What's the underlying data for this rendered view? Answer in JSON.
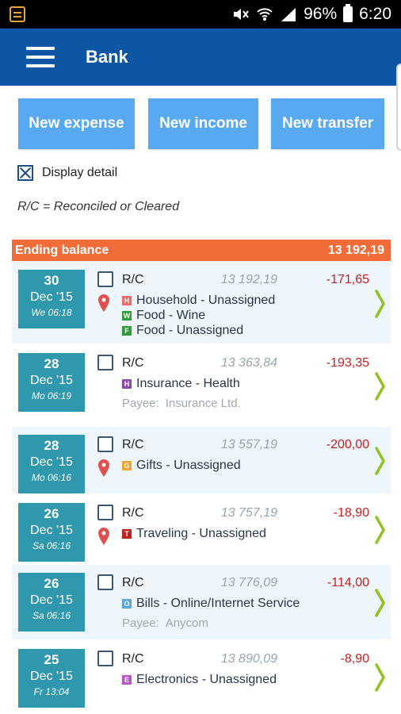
{
  "status_bar": {
    "battery": "96%",
    "time": "6:20"
  },
  "app_bar": {
    "title": "Bank"
  },
  "buttons": {
    "new_expense": "New expense",
    "new_income": "New income",
    "new_transfer": "New transfer"
  },
  "display_detail": {
    "label": "Display detail",
    "checked": true
  },
  "legend": "R/C = Reconciled or Cleared",
  "ending_balance": {
    "label": "Ending balance",
    "value": "13 192,19"
  },
  "transactions": [
    {
      "day": "30",
      "month": "Dec '15",
      "weekday_time": "We 06:18",
      "rc": "R/C",
      "running_balance": "13 192,19",
      "amount": "-171,65",
      "has_location": true,
      "categories": [
        {
          "badge": "H",
          "color": "#ec6a6a",
          "text": "Household - Unassigned"
        },
        {
          "badge": "W",
          "color": "#2e9d3a",
          "text": "Food - Wine"
        },
        {
          "badge": "F",
          "color": "#2e9d3a",
          "text": "Food - Unassigned"
        }
      ],
      "payee_label": "",
      "payee": ""
    },
    {
      "day": "28",
      "month": "Dec '15",
      "weekday_time": "Mo 06:19",
      "rc": "R/C",
      "running_balance": "13 363,84",
      "amount": "-193,35",
      "has_location": false,
      "categories": [
        {
          "badge": "H",
          "color": "#8b4aa8",
          "text": "Insurance - Health"
        }
      ],
      "payee_label": "Payee:",
      "payee": "Insurance Ltd."
    },
    {
      "day": "28",
      "month": "Dec '15",
      "weekday_time": "Mo 06:16",
      "rc": "R/C",
      "running_balance": "13 557,19",
      "amount": "-200,00",
      "has_location": true,
      "categories": [
        {
          "badge": "G",
          "color": "#f0a530",
          "text": "Gifts - Unassigned"
        }
      ],
      "payee_label": "",
      "payee": ""
    },
    {
      "day": "26",
      "month": "Dec '15",
      "weekday_time": "Sa 06:16",
      "rc": "R/C",
      "running_balance": "13 757,19",
      "amount": "-18,90",
      "has_location": true,
      "categories": [
        {
          "badge": "T",
          "color": "#c41e1e",
          "text": "Traveling - Unassigned"
        }
      ],
      "payee_label": "",
      "payee": ""
    },
    {
      "day": "26",
      "month": "Dec '15",
      "weekday_time": "Sa 06:16",
      "rc": "R/C",
      "running_balance": "13 776,09",
      "amount": "-114,00",
      "has_location": false,
      "categories": [
        {
          "badge": "O",
          "color": "#5aa7e0",
          "text": "Bills - Online/Internet Service"
        }
      ],
      "payee_label": "Payee:",
      "payee": "Anycom"
    },
    {
      "day": "25",
      "month": "Dec '15",
      "weekday_time": "Fr 13:04",
      "rc": "R/C",
      "running_balance": "13 890,09",
      "amount": "-8,90",
      "has_location": false,
      "categories": [
        {
          "badge": "E",
          "color": "#b655c4",
          "text": "Electronics - Unassigned"
        }
      ],
      "payee_label": "",
      "payee": ""
    }
  ],
  "colors": {
    "app_bar": "#0d56a6",
    "button": "#58a9f0",
    "balance_bar": "#f26c3a",
    "date_box": "#2f98ad",
    "amount_negative": "#c72020",
    "chevron": "#8fc31f",
    "pin": "#e05050"
  }
}
